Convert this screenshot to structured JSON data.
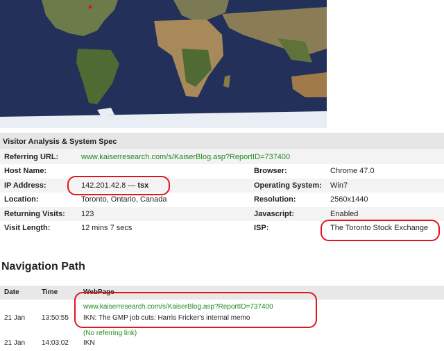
{
  "visitor": {
    "section_title": "Visitor Analysis & System Spec",
    "referring_url": {
      "label": "Referring URL:",
      "value": "www.kaiserresearch.com/s/KaiserBlog.asp?ReportID=737400"
    },
    "host_name": {
      "label": "Host Name:",
      "value": ""
    },
    "ip_address": {
      "label": "IP Address:",
      "value": "142.201.42.8",
      "sep": "—",
      "host": "tsx"
    },
    "location": {
      "label": "Location:",
      "value": "Toronto, Ontario, Canada"
    },
    "returning_visits": {
      "label": "Returning Visits:",
      "value": "123"
    },
    "visit_length": {
      "label": "Visit Length:",
      "value": "12 mins 7 secs"
    },
    "browser": {
      "label": "Browser:",
      "value": "Chrome 47.0"
    },
    "os": {
      "label": "Operating System:",
      "value": "Win7"
    },
    "resolution": {
      "label": "Resolution:",
      "value": "2560x1440"
    },
    "javascript": {
      "label": "Javascript:",
      "value": "Enabled"
    },
    "isp": {
      "label": "ISP:",
      "value": "The Toronto Stock Exchange"
    }
  },
  "navigation": {
    "title": "Navigation Path",
    "columns": {
      "date": "Date",
      "time": "Time",
      "webpage": "WebPage"
    },
    "rows": [
      {
        "date": "21 Jan",
        "time": "13:50:55",
        "url": "www.kaiserresearch.com/s/KaiserBlog.asp?ReportID=737400",
        "page": "IKN: The GMP job cuts: Harris Fricker's internal memo"
      },
      {
        "date": "21 Jan",
        "time": "14:03:02",
        "url": "(No referring link)",
        "page": "IKN"
      }
    ]
  },
  "colors": {
    "link": "#1f8a1f",
    "highlight_circle": "#e0141e",
    "map_ocean": "#23305a"
  }
}
